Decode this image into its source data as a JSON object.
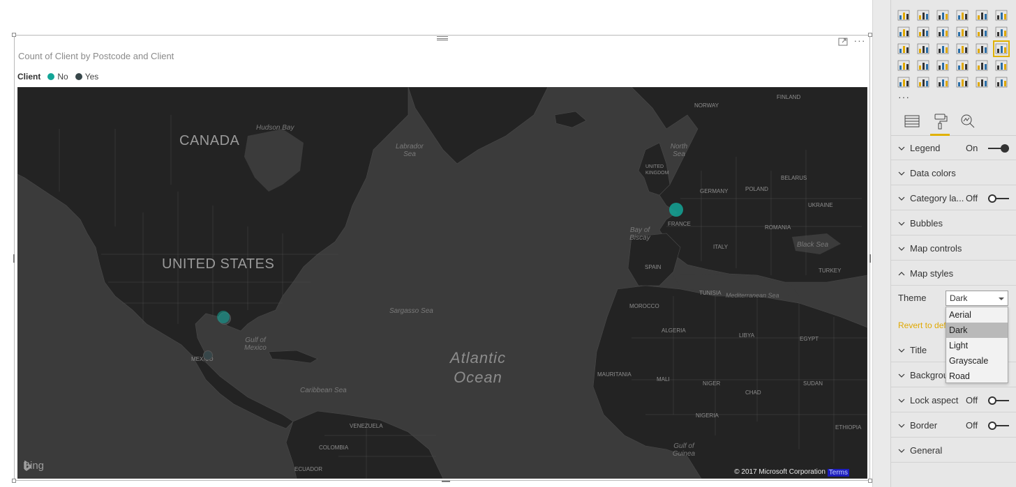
{
  "visual": {
    "title": "Count of Client by Postcode and Client",
    "legend": {
      "title": "Client",
      "items": [
        {
          "label": "No",
          "color": "#13a597"
        },
        {
          "label": "Yes",
          "color": "#374649"
        }
      ]
    }
  },
  "map": {
    "labels": {
      "canada": "CANADA",
      "united_states": "UNITED STATES",
      "mexico": "MEXICO",
      "hudson_bay": "Hudson Bay",
      "labrador_sea": "Labrador Sea",
      "north_sea": "North Sea",
      "biscay": "Bay of Biscay",
      "black_sea": "Black Sea",
      "mediterranean": "Mediterranean Sea",
      "gulf_mexico": "Gulf of Mexico",
      "sargasso": "Sargasso Sea",
      "caribbean": "Caribbean Sea",
      "gulf_guinea": "Gulf of Guinea",
      "atlantic": "Atlantic Ocean",
      "finland": "FINLAND",
      "norway": "NORWAY",
      "uk": "UNITED KINGDOM",
      "germany": "GERMANY",
      "poland": "POLAND",
      "belarus": "BELARUS",
      "ukraine": "UKRAINE",
      "france": "FRANCE",
      "romania": "ROMANIA",
      "italy": "ITALY",
      "spain": "SPAIN",
      "turkey": "TURKEY",
      "tunisia": "TUNISIA",
      "morocco": "MOROCCO",
      "algeria": "ALGERIA",
      "libya": "LIBYA",
      "egypt": "EGYPT",
      "mauritania": "MAURITANIA",
      "mali": "MALI",
      "niger": "NIGER",
      "chad": "CHAD",
      "sudan": "SUDAN",
      "nigeria": "NIGERIA",
      "ethiopia": "ETHIOPIA",
      "venezuela": "VENEZUELA",
      "colombia": "COLOMBIA",
      "ecuador": "ECUADOR"
    },
    "bubbles": [
      {
        "place": "France",
        "series": "No"
      },
      {
        "place": "Texas",
        "series": "No"
      },
      {
        "place": "Texas",
        "series": "Yes"
      },
      {
        "place": "Mexico",
        "series": "Yes"
      }
    ],
    "bing": "Bing",
    "copyright": "© 2017 Microsoft Corporation",
    "terms": "Terms"
  },
  "pane": {
    "viz_icons": [
      "stacked-bar-icon",
      "stacked-column-icon",
      "clustered-bar-icon",
      "clustered-column-icon",
      "100-stacked-bar-icon",
      "100-stacked-column-icon",
      "line-chart-icon",
      "area-chart-icon",
      "stacked-area-icon",
      "line-clustered-column-icon",
      "line-stacked-column-icon",
      "ribbon-chart-icon",
      "waterfall-icon",
      "scatter-icon",
      "pie-icon",
      "donut-icon",
      "treemap-icon",
      "map-icon",
      "filled-map-icon",
      "shape-map-icon",
      "funnel-icon",
      "gauge-icon",
      "card-icon",
      "multi-row-card-icon",
      "kpi-icon",
      "slicer-icon",
      "table-icon",
      "matrix-icon",
      "r-visual-icon",
      "globe-icon"
    ],
    "tabs": [
      "fields-icon",
      "format-paint-icon",
      "analytics-icon"
    ],
    "sections": [
      {
        "label": "Legend",
        "state": "On",
        "toggle": "on"
      },
      {
        "label": "Data colors"
      },
      {
        "label": "Category la...",
        "state": "Off",
        "toggle": "off"
      },
      {
        "label": "Bubbles"
      },
      {
        "label": "Map controls"
      },
      {
        "label": "Map styles",
        "expanded": true
      }
    ],
    "sections_lower": [
      {
        "label": "Title"
      },
      {
        "label": "Backgrou"
      },
      {
        "label": "Lock aspect",
        "state": "Off",
        "toggle": "off"
      },
      {
        "label": "Border",
        "state": "Off",
        "toggle": "off"
      },
      {
        "label": "General"
      }
    ],
    "theme": {
      "label": "Theme",
      "value": "Dark",
      "options": [
        "Aerial",
        "Dark",
        "Light",
        "Grayscale",
        "Road"
      ],
      "highlighted": "Dark"
    },
    "revert": "Revert to def",
    "accent": "#e0b100"
  }
}
